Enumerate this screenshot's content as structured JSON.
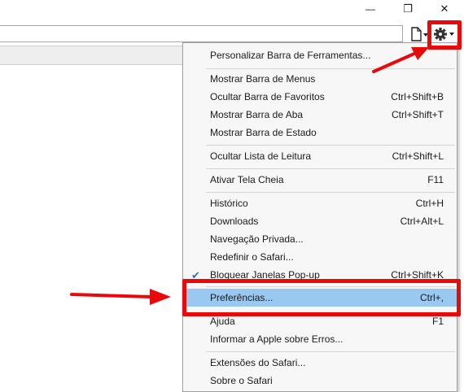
{
  "window": {
    "minimize_glyph": "—",
    "restore_glyph": "❐",
    "close_glyph": "✕"
  },
  "toolbar": {
    "page_icon": "page-icon",
    "gear_icon": "gear-icon"
  },
  "menu": {
    "items": [
      {
        "label": "Personalizar Barra de Ferramentas...",
        "shortcut": ""
      },
      {
        "label": "Mostrar Barra de Menus",
        "shortcut": ""
      },
      {
        "label": "Ocultar Barra de Favoritos",
        "shortcut": "Ctrl+Shift+B"
      },
      {
        "label": "Mostrar Barra de Aba",
        "shortcut": "Ctrl+Shift+T"
      },
      {
        "label": "Mostrar Barra de Estado",
        "shortcut": ""
      },
      {
        "label": "Ocultar Lista de Leitura",
        "shortcut": "Ctrl+Shift+L"
      },
      {
        "label": "Ativar Tela Cheia",
        "shortcut": "F11"
      },
      {
        "label": "Histórico",
        "shortcut": "Ctrl+H"
      },
      {
        "label": "Downloads",
        "shortcut": "Ctrl+Alt+L"
      },
      {
        "label": "Navegação Privada...",
        "shortcut": ""
      },
      {
        "label": "Redefinir o Safari...",
        "shortcut": ""
      },
      {
        "label": "Bloquear Janelas Pop-up",
        "shortcut": "Ctrl+Shift+K",
        "checked": true
      },
      {
        "label": "Preferências...",
        "shortcut": "Ctrl+,",
        "selected": true
      },
      {
        "label": "Ajuda",
        "shortcut": "F1"
      },
      {
        "label": "Informar a Apple sobre Erros...",
        "shortcut": ""
      },
      {
        "label": "Extensões do Safari...",
        "shortcut": ""
      },
      {
        "label": "Sobre o Safari",
        "shortcut": ""
      }
    ]
  },
  "colors": {
    "annotation_red": "#e8090b",
    "selection_blue": "#99c9f1",
    "check_blue": "#2d6fbf"
  }
}
